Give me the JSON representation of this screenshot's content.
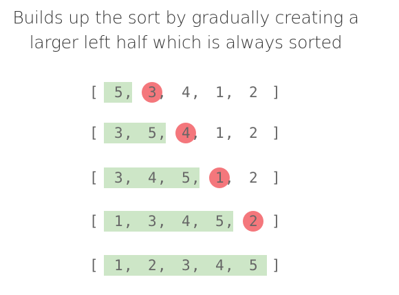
{
  "caption": {
    "line1": "Builds up the sort by gradually creating a",
    "line2": "larger left half which is always sorted"
  },
  "colors": {
    "sorted_highlight": "#cde6c7",
    "current_element": "#f4777c",
    "text": "#666666",
    "caption_text": "#333333"
  },
  "rows": [
    {
      "values": [
        "5",
        "3",
        "4",
        "1",
        "2"
      ],
      "sorted_count": 1,
      "current_index": 1
    },
    {
      "values": [
        "3",
        "5",
        "4",
        "1",
        "2"
      ],
      "sorted_count": 2,
      "current_index": 2
    },
    {
      "values": [
        "3",
        "4",
        "5",
        "1",
        "2"
      ],
      "sorted_count": 3,
      "current_index": 3
    },
    {
      "values": [
        "1",
        "3",
        "4",
        "5",
        "2"
      ],
      "sorted_count": 4,
      "current_index": 4
    },
    {
      "values": [
        "1",
        "2",
        "3",
        "4",
        "5"
      ],
      "sorted_count": 5,
      "current_index": null
    }
  ],
  "brackets": {
    "open": "[",
    "close": "]",
    "separator": ","
  }
}
